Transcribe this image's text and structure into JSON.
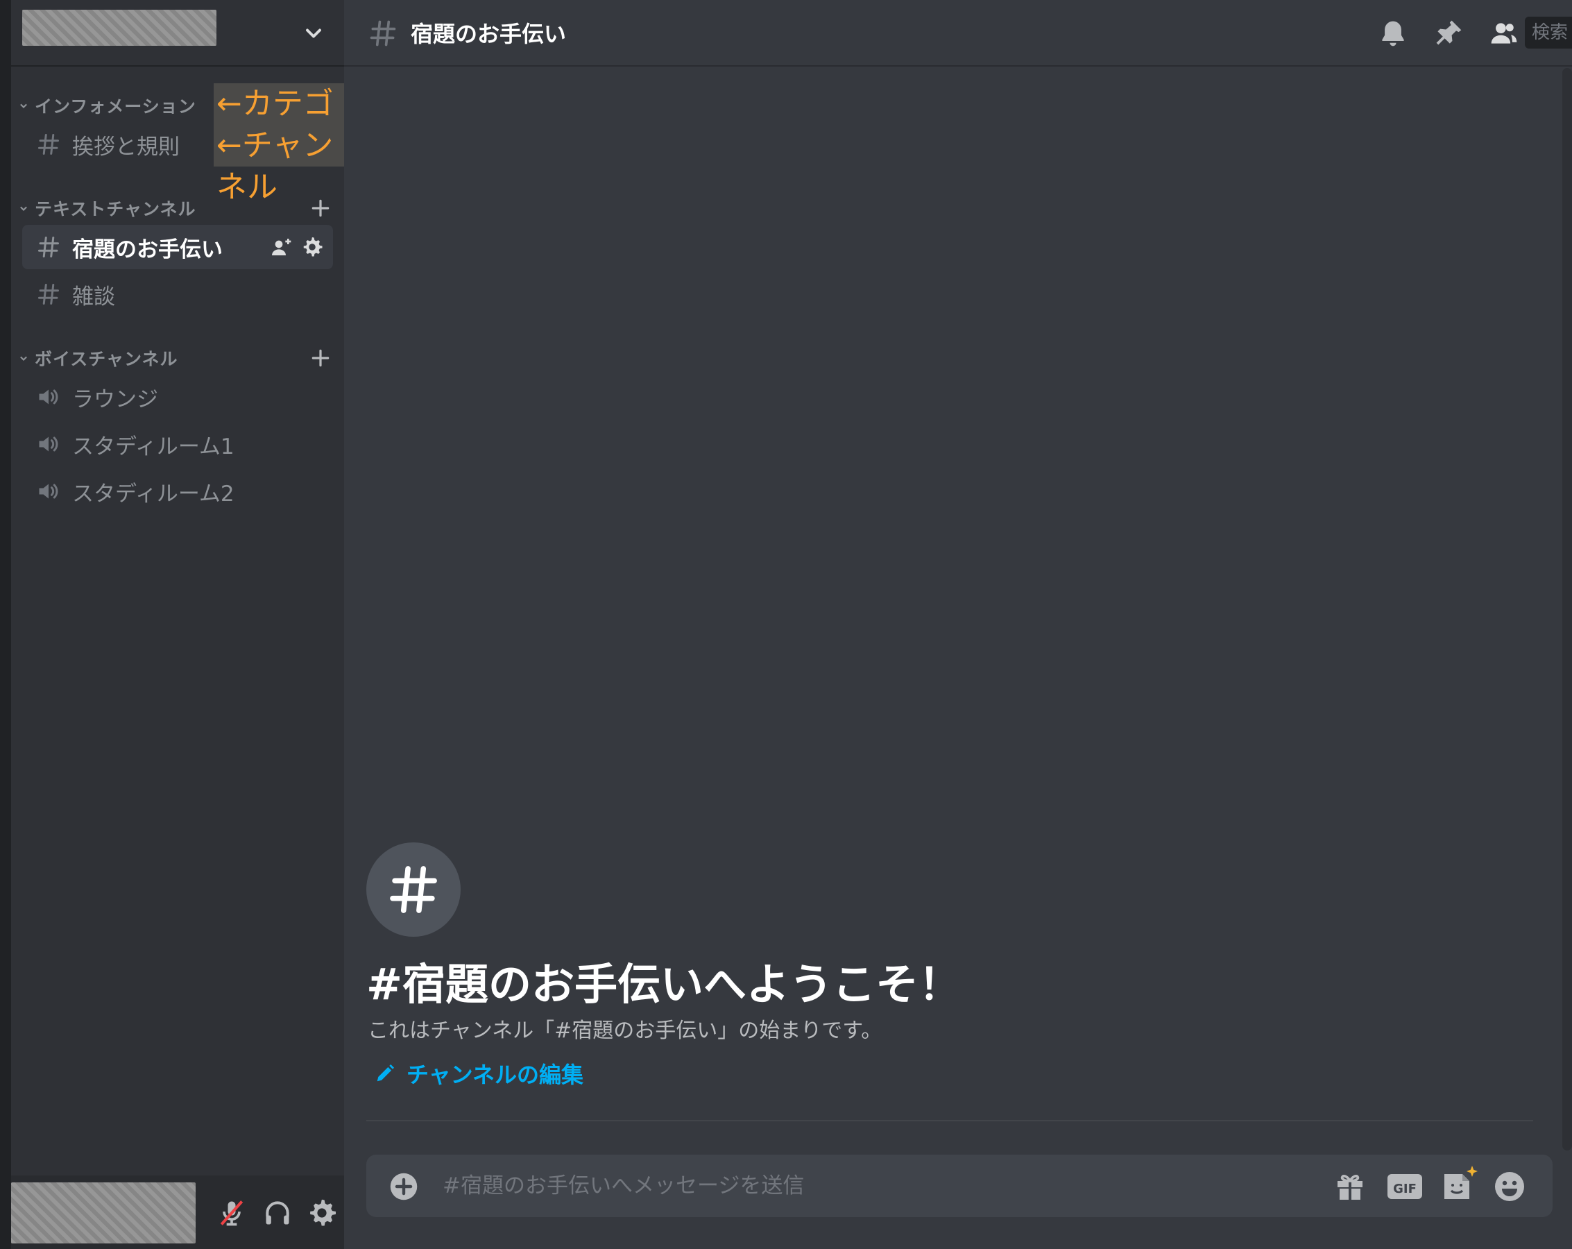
{
  "colors": {
    "sidebar_bg": "#2f3136",
    "main_bg": "#36393f",
    "accent_link": "#00aff4",
    "annotation_text": "#f7a032",
    "muted_text": "#8e9297",
    "mute_slash": "#ed4245"
  },
  "sidebar": {
    "categories": [
      {
        "label": "インフォメーション",
        "channels": [
          {
            "label": "挨拶と規則",
            "type": "text"
          }
        ]
      },
      {
        "label": "テキストチャンネル",
        "channels": [
          {
            "label": "宿題のお手伝い",
            "type": "text",
            "active": true
          },
          {
            "label": "雑談",
            "type": "text"
          }
        ]
      },
      {
        "label": "ボイスチャンネル",
        "channels": [
          {
            "label": "ラウンジ",
            "type": "voice"
          },
          {
            "label": "スタディルーム1",
            "type": "voice"
          },
          {
            "label": "スタディルーム2",
            "type": "voice"
          }
        ]
      }
    ],
    "annotations": {
      "category": "←カテゴリ",
      "channel": "←チャンネル"
    },
    "icons": [
      "chevron-down-icon",
      "hash-icon",
      "speaker-icon",
      "plus-icon",
      "invite-icon",
      "gear-icon"
    ]
  },
  "user_panel": {
    "icons": [
      "mic-muted-icon",
      "headphones-icon",
      "settings-icon"
    ]
  },
  "header": {
    "channel_name": "宿題のお手伝い",
    "search_label": "検索",
    "icons": [
      "bell-icon",
      "pin-icon",
      "members-icon"
    ]
  },
  "welcome": {
    "title": "#宿題のお手伝いへようこそ！",
    "description": "これはチャンネル「#宿題のお手伝い」の始まりです。",
    "edit_link": "チャンネルの編集"
  },
  "composer": {
    "placeholder": "#宿題のお手伝いへメッセージを送信",
    "icons": [
      "add-attachment-icon",
      "gift-icon",
      "gif-icon",
      "sticker-icon",
      "emoji-icon"
    ]
  }
}
